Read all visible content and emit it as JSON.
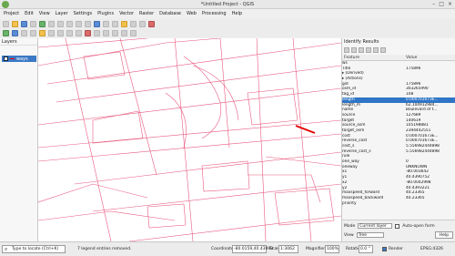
{
  "window": {
    "title": "*Untitled Project - QGIS"
  },
  "menu": [
    "Project",
    "Edit",
    "View",
    "Layer",
    "Settings",
    "Plugins",
    "Vector",
    "Raster",
    "Database",
    "Web",
    "Processing",
    "Help"
  ],
  "layers_panel": {
    "title": "Layers",
    "layer_name": "ways"
  },
  "identify": {
    "title": "Identify Results",
    "col_field": "Feature",
    "col_value": "Value",
    "rows": [
      {
        "f": "ws",
        "v": "",
        "sel": false
      },
      {
        "f": "  Title",
        "v": "175896",
        "sel": false
      },
      {
        "f": "  ▸ (Derived)",
        "v": "",
        "sel": false
      },
      {
        "f": "  ▸ (Actions)",
        "v": "",
        "sel": false
      },
      {
        "f": "  gid",
        "v": "175896",
        "sel": false
      },
      {
        "f": "  osm_id",
        "v": "303265990",
        "sel": false
      },
      {
        "f": "  tag_id",
        "v": "108",
        "sel": false
      },
      {
        "f": "  length",
        "v": "0.000701673E...",
        "sel": true
      },
      {
        "f": "  length_m",
        "v": "62.104912984...",
        "sel": false
      },
      {
        "f": "  name",
        "v": "Boulevard of t...",
        "sel": false
      },
      {
        "f": "  source",
        "v": "127689",
        "sel": false
      },
      {
        "f": "  target",
        "v": "140619",
        "sel": false
      },
      {
        "f": "  source_osm",
        "v": "105198881",
        "sel": false
      },
      {
        "f": "  target_osm",
        "v": "2394442551",
        "sel": false
      },
      {
        "f": "  cost",
        "v": "0.000701673E...",
        "sel": false
      },
      {
        "f": "  reverse_cost",
        "v": "0.000701673E...",
        "sel": false
      },
      {
        "f": "  cost_s",
        "v": "5.556982444898",
        "sel": false
      },
      {
        "f": "  reverse_cost_s",
        "v": "5.556982444898",
        "sel": false
      },
      {
        "f": "  rule",
        "v": "",
        "sel": false
      },
      {
        "f": "  one_way",
        "v": "0",
        "sel": false
      },
      {
        "f": "  oneway",
        "v": "UNKNOWN",
        "sel": false
      },
      {
        "f": "  x1",
        "v": "-80.003643",
        "sel": false
      },
      {
        "f": "  y1",
        "v": "40.4390752",
        "sel": false
      },
      {
        "f": "  x2",
        "v": "-80.0042998",
        "sel": false
      },
      {
        "f": "  y2",
        "v": "40.4393221",
        "sel": false
      },
      {
        "f": "  maxspeed_forward",
        "v": "40.23365",
        "sel": false
      },
      {
        "f": "  maxspeed_backward",
        "v": "40.23365",
        "sel": false
      },
      {
        "f": "  priority",
        "v": "",
        "sel": false
      }
    ],
    "mode_label": "Mode",
    "mode_value": "Current layer",
    "view_label": "View",
    "view_value": "Tree",
    "auto_open": "Auto-open form",
    "help": "Help"
  },
  "status": {
    "locate_placeholder": "Type to locate (Ctrl+K)",
    "message": "7 legend entries removed.",
    "coord_label": "Coordinate",
    "coord_value": "-80.0159,40.43999",
    "scale_label": "Scale",
    "scale_value": "1:3062",
    "magnifier_label": "Magnifier",
    "magnifier_value": "100%",
    "rotation_label": "Rotation",
    "rotation_value": "0.0 °",
    "render_label": "Render",
    "epsg": "EPSG:4326"
  }
}
